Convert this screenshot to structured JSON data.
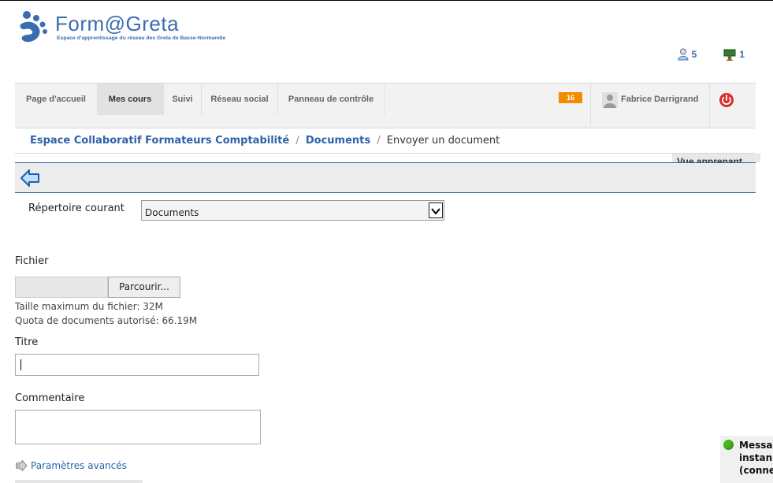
{
  "brand": {
    "title": "Form@Greta",
    "subtitle": "Espace d'apprentissage du réseau des Greta de Basse-Normandie"
  },
  "header_counters": {
    "users_online": "5",
    "courses_count": "1"
  },
  "navbar": {
    "items": [
      {
        "label": "Page d'accueil",
        "active": false
      },
      {
        "label": "Mes cours",
        "active": true
      },
      {
        "label": "Suivi",
        "active": false
      },
      {
        "label": "Réseau social",
        "active": false
      },
      {
        "label": "Panneau de contrôle",
        "active": false
      }
    ],
    "notifications": "16",
    "user_name": "Fabrice Darrigrand"
  },
  "breadcrumb": {
    "course": "Espace Collaboratif Formateurs Comptabilité",
    "separator": "/",
    "section": "Documents",
    "current": "Envoyer un document"
  },
  "view_tab": "Vue apprenant",
  "form": {
    "directory_label": "Répertoire courant",
    "directory_value": "Documents",
    "file_label": "Fichier",
    "browse_label": "Parcourir...",
    "max_size": "Taille maximum du fichier: 32M",
    "quota": "Quota de documents autorisé: 66.19M",
    "title_label": "Titre",
    "title_value": "",
    "comment_label": "Commentaire",
    "comment_value": "",
    "advanced_label": "Paramètres avancés"
  },
  "chat": {
    "line1": "Messa",
    "line2": "instan",
    "line3": "(conne"
  },
  "colors": {
    "brand_blue": "#3a6db0",
    "link_blue": "#2d62a8",
    "badge_orange": "#f28c00",
    "online_green": "#4ab520",
    "logout_red": "#d9302c"
  },
  "icons": [
    "brand-logo-icon",
    "user-online-icon",
    "course-icon",
    "user-avatar-icon",
    "power-icon",
    "back-arrow-icon",
    "chevron-down-icon",
    "arrow-right-icon",
    "online-status-icon"
  ]
}
